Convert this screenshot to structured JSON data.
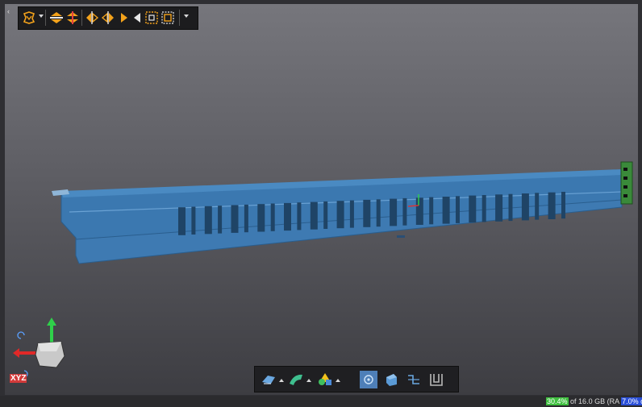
{
  "status": {
    "memory_pct": "30.4%",
    "memory_text": "of 16.0 GB (RA",
    "secondary_pct": "7.0% o"
  },
  "gizmo": {
    "axis_label": "XYZ"
  },
  "colors": {
    "model_fill": "#3b78b0",
    "model_dark": "#1f4466",
    "viewport_top": "#76767c",
    "viewport_bottom": "#3d3d42",
    "toolbar_bg": "#1c1c1e",
    "accent_orange": "#f3a21b",
    "accent_green": "#3fbf3f",
    "accent_blue": "#2a4fd8"
  },
  "icons": {
    "top_toolbar": [
      "select-icon",
      "flip-horizontal-icon",
      "flip-vertical-icon",
      "mirror-left-icon",
      "mirror-right-icon",
      "arrow-left-icon",
      "zoom-fit-icon",
      "zoom-window-icon"
    ],
    "bottom_toolbar": [
      "sketch-icon",
      "sweep-icon",
      "shapes-icon",
      "view-cube-icon",
      "section-icon",
      "measure-icon",
      "profile-icon"
    ]
  }
}
